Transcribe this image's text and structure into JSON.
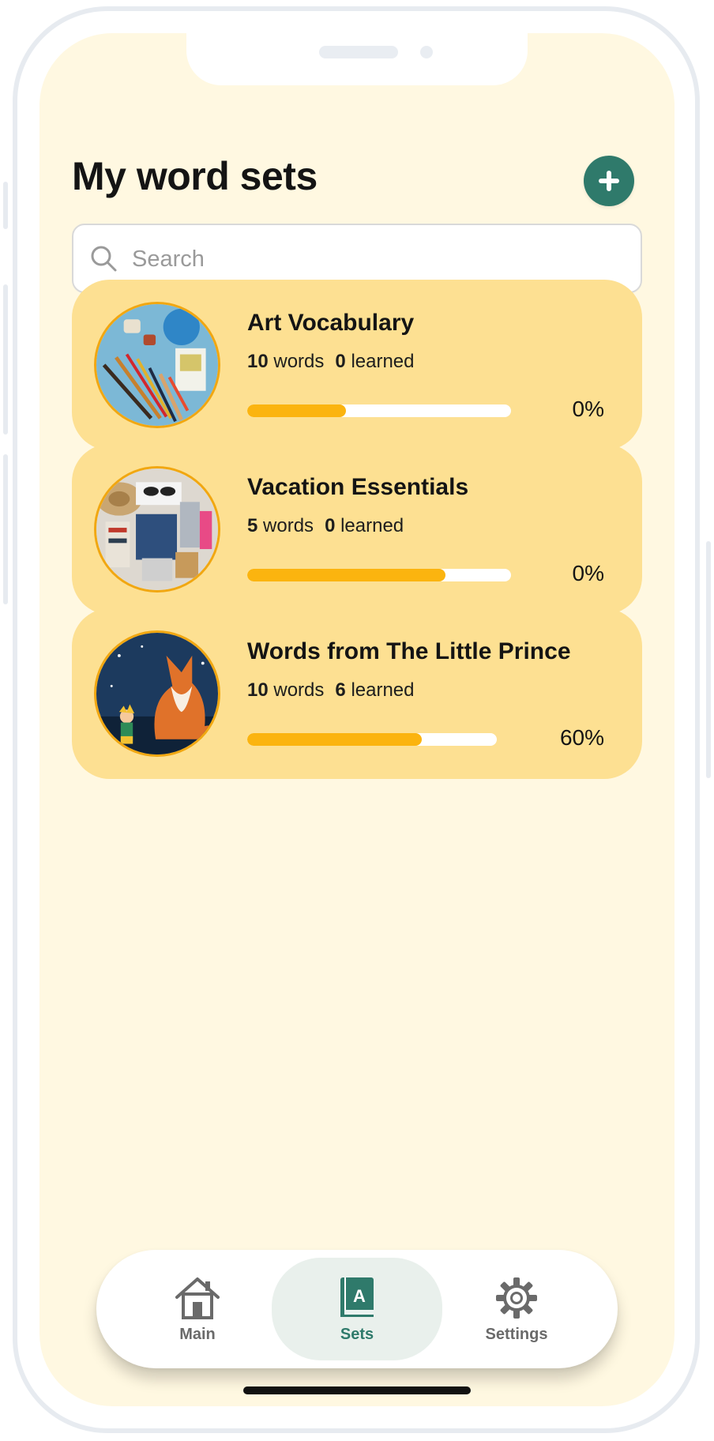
{
  "header": {
    "title": "My word sets",
    "add_icon": "plus-icon"
  },
  "search": {
    "placeholder": "Search",
    "value": "",
    "icon": "search-icon"
  },
  "word_sets": [
    {
      "title": "Art Vocabulary",
      "words_count": "10",
      "words_label": "words",
      "learned_count": "0",
      "learned_label": "learned",
      "progress_percent": "0%",
      "bar_fill": 0.375,
      "image": "art-supplies-image"
    },
    {
      "title": "Vacation Essentials",
      "words_count": "5",
      "words_label": "words",
      "learned_count": "0",
      "learned_label": "learned",
      "progress_percent": "0%",
      "bar_fill": 0.75,
      "image": "vacation-luggage-image"
    },
    {
      "title": "Words from The Little Prince",
      "words_count": "10",
      "words_label": "words",
      "learned_count": "6",
      "learned_label": "learned",
      "progress_percent": "60%",
      "bar_fill": 0.7,
      "image": "little-prince-fox-image"
    }
  ],
  "nav": {
    "items": [
      {
        "label": "Main",
        "icon": "home-icon",
        "active": false
      },
      {
        "label": "Sets",
        "icon": "book-icon",
        "active": true
      },
      {
        "label": "Settings",
        "icon": "gear-icon",
        "active": false
      }
    ]
  },
  "colors": {
    "background": "#fff8e1",
    "card": "#fde092",
    "accent": "#2f7a6b",
    "progress_fill": "#fbb40f",
    "progress_track": "#ffffff"
  }
}
